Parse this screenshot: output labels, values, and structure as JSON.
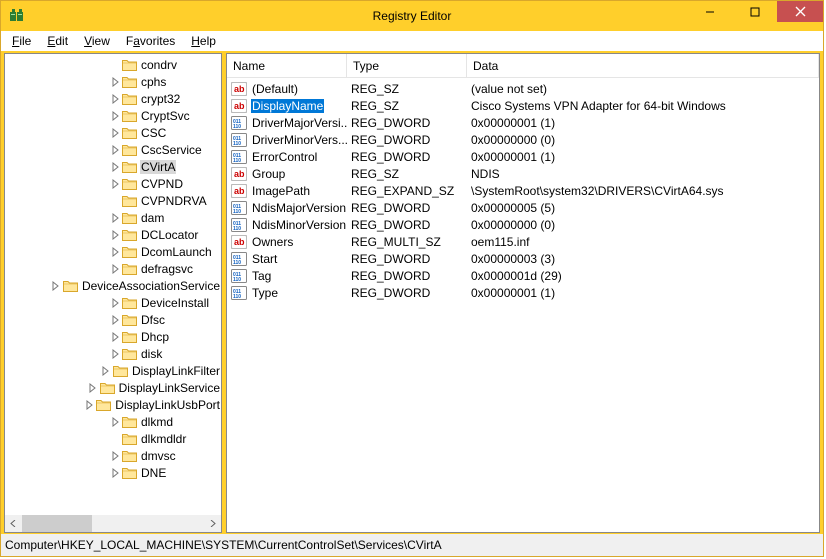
{
  "window": {
    "title": "Registry Editor"
  },
  "menu": {
    "file": "File",
    "edit": "Edit",
    "view": "View",
    "favorites": "Favorites",
    "help": "Help"
  },
  "columns": {
    "name": "Name",
    "type": "Type",
    "data": "Data"
  },
  "tree": {
    "items": [
      {
        "label": "condrv",
        "depth": 7,
        "expander": "none"
      },
      {
        "label": "cphs",
        "depth": 7,
        "expander": "closed"
      },
      {
        "label": "crypt32",
        "depth": 7,
        "expander": "closed"
      },
      {
        "label": "CryptSvc",
        "depth": 7,
        "expander": "closed"
      },
      {
        "label": "CSC",
        "depth": 7,
        "expander": "closed"
      },
      {
        "label": "CscService",
        "depth": 7,
        "expander": "closed"
      },
      {
        "label": "CVirtA",
        "depth": 7,
        "expander": "closed",
        "selected": true
      },
      {
        "label": "CVPND",
        "depth": 7,
        "expander": "closed"
      },
      {
        "label": "CVPNDRVA",
        "depth": 7,
        "expander": "none"
      },
      {
        "label": "dam",
        "depth": 7,
        "expander": "closed"
      },
      {
        "label": "DCLocator",
        "depth": 7,
        "expander": "closed"
      },
      {
        "label": "DcomLaunch",
        "depth": 7,
        "expander": "closed"
      },
      {
        "label": "defragsvc",
        "depth": 7,
        "expander": "closed"
      },
      {
        "label": "DeviceAssociationService",
        "depth": 7,
        "expander": "closed"
      },
      {
        "label": "DeviceInstall",
        "depth": 7,
        "expander": "closed"
      },
      {
        "label": "Dfsc",
        "depth": 7,
        "expander": "closed"
      },
      {
        "label": "Dhcp",
        "depth": 7,
        "expander": "closed"
      },
      {
        "label": "disk",
        "depth": 7,
        "expander": "closed"
      },
      {
        "label": "DisplayLinkFilter",
        "depth": 7,
        "expander": "closed"
      },
      {
        "label": "DisplayLinkService",
        "depth": 7,
        "expander": "closed"
      },
      {
        "label": "DisplayLinkUsbPort",
        "depth": 7,
        "expander": "closed"
      },
      {
        "label": "dlkmd",
        "depth": 7,
        "expander": "closed"
      },
      {
        "label": "dlkmdldr",
        "depth": 7,
        "expander": "none"
      },
      {
        "label": "dmvsc",
        "depth": 7,
        "expander": "closed"
      },
      {
        "label": "DNE",
        "depth": 7,
        "expander": "closed"
      }
    ]
  },
  "values": [
    {
      "name": "(Default)",
      "type": "REG_SZ",
      "data": "(value not set)",
      "kind": "sz"
    },
    {
      "name": "DisplayName",
      "type": "REG_SZ",
      "data": "Cisco Systems VPN Adapter for 64-bit Windows",
      "kind": "sz",
      "selected": true
    },
    {
      "name": "DriverMajorVersi...",
      "type": "REG_DWORD",
      "data": "0x00000001 (1)",
      "kind": "bin"
    },
    {
      "name": "DriverMinorVers...",
      "type": "REG_DWORD",
      "data": "0x00000000 (0)",
      "kind": "bin"
    },
    {
      "name": "ErrorControl",
      "type": "REG_DWORD",
      "data": "0x00000001 (1)",
      "kind": "bin"
    },
    {
      "name": "Group",
      "type": "REG_SZ",
      "data": "NDIS",
      "kind": "sz"
    },
    {
      "name": "ImagePath",
      "type": "REG_EXPAND_SZ",
      "data": "\\SystemRoot\\system32\\DRIVERS\\CVirtA64.sys",
      "kind": "sz"
    },
    {
      "name": "NdisMajorVersion",
      "type": "REG_DWORD",
      "data": "0x00000005 (5)",
      "kind": "bin"
    },
    {
      "name": "NdisMinorVersion",
      "type": "REG_DWORD",
      "data": "0x00000000 (0)",
      "kind": "bin"
    },
    {
      "name": "Owners",
      "type": "REG_MULTI_SZ",
      "data": "oem115.inf",
      "kind": "sz"
    },
    {
      "name": "Start",
      "type": "REG_DWORD",
      "data": "0x00000003 (3)",
      "kind": "bin"
    },
    {
      "name": "Tag",
      "type": "REG_DWORD",
      "data": "0x0000001d (29)",
      "kind": "bin"
    },
    {
      "name": "Type",
      "type": "REG_DWORD",
      "data": "0x00000001 (1)",
      "kind": "bin"
    }
  ],
  "status": {
    "path": "Computer\\HKEY_LOCAL_MACHINE\\SYSTEM\\CurrentControlSet\\Services\\CVirtA"
  }
}
